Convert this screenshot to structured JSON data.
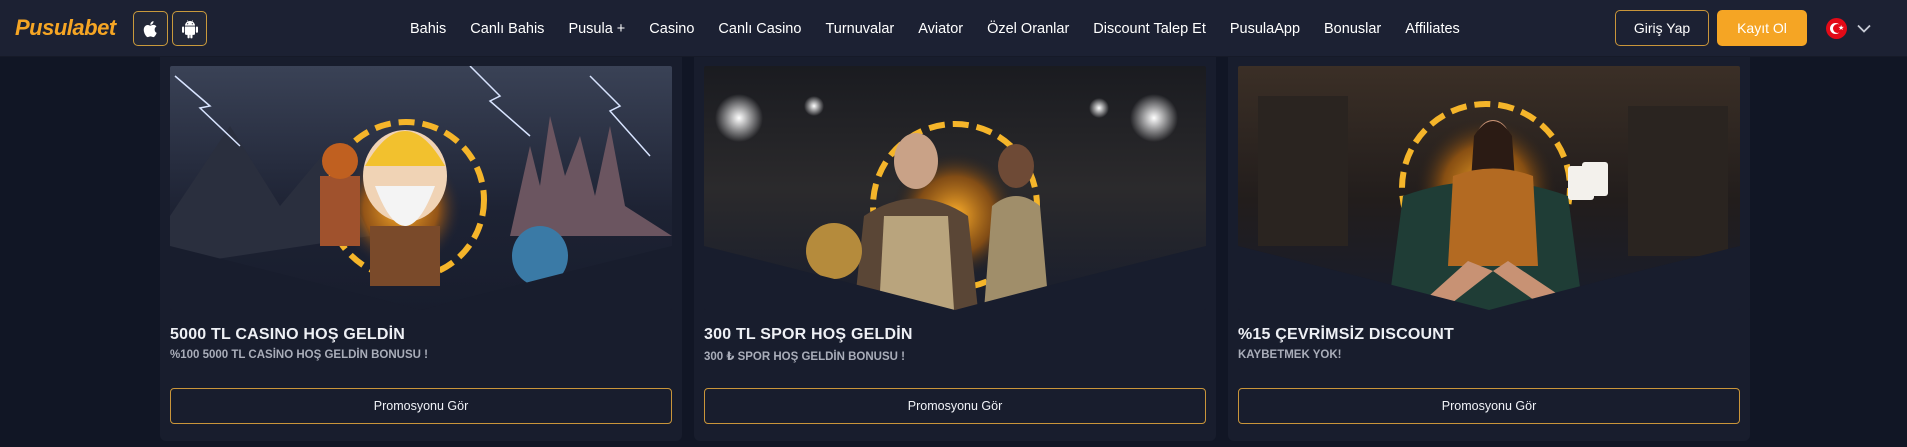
{
  "header": {
    "logo_part1": "Pusula",
    "logo_part2": "bet",
    "apps": [
      {
        "icon": "apple-icon"
      },
      {
        "icon": "android-icon"
      }
    ],
    "nav": [
      "Bahis",
      "Canlı Bahis",
      "Pusula +",
      "Casino",
      "Canlı Casino",
      "Turnuvalar",
      "Aviator",
      "Özel Oranlar",
      "Discount Talep Et",
      "PusulaApp",
      "Bonuslar",
      "Affiliates"
    ],
    "login_label": "Giriş Yap",
    "register_label": "Kayıt Ol",
    "language_flag": "turkey-flag-icon"
  },
  "colors": {
    "accent": "#f5a524",
    "background": "#111625",
    "header": "#1c2133",
    "card": "#181d2d"
  },
  "promotions": [
    {
      "title": "5000 TL CASINO HOŞ GELDİN",
      "subtitle": "%100 5000 TL  CASİNO HOŞ GELDİN BONUSU !",
      "button_label": "Promosyonu Gör",
      "image": "casino-welcome-banner"
    },
    {
      "title": "300 TL SPOR HOŞ GELDİN",
      "subtitle": "300 ₺ SPOR HOŞ GELDİN BONUSU !",
      "button_label": "Promosyonu Gör",
      "image": "sports-welcome-banner"
    },
    {
      "title": "%15 ÇEVRİMSİZ DISCOUNT",
      "subtitle": "KAYBETMEK YOK!",
      "button_label": "Promosyonu Gör",
      "image": "discount-banner"
    }
  ]
}
